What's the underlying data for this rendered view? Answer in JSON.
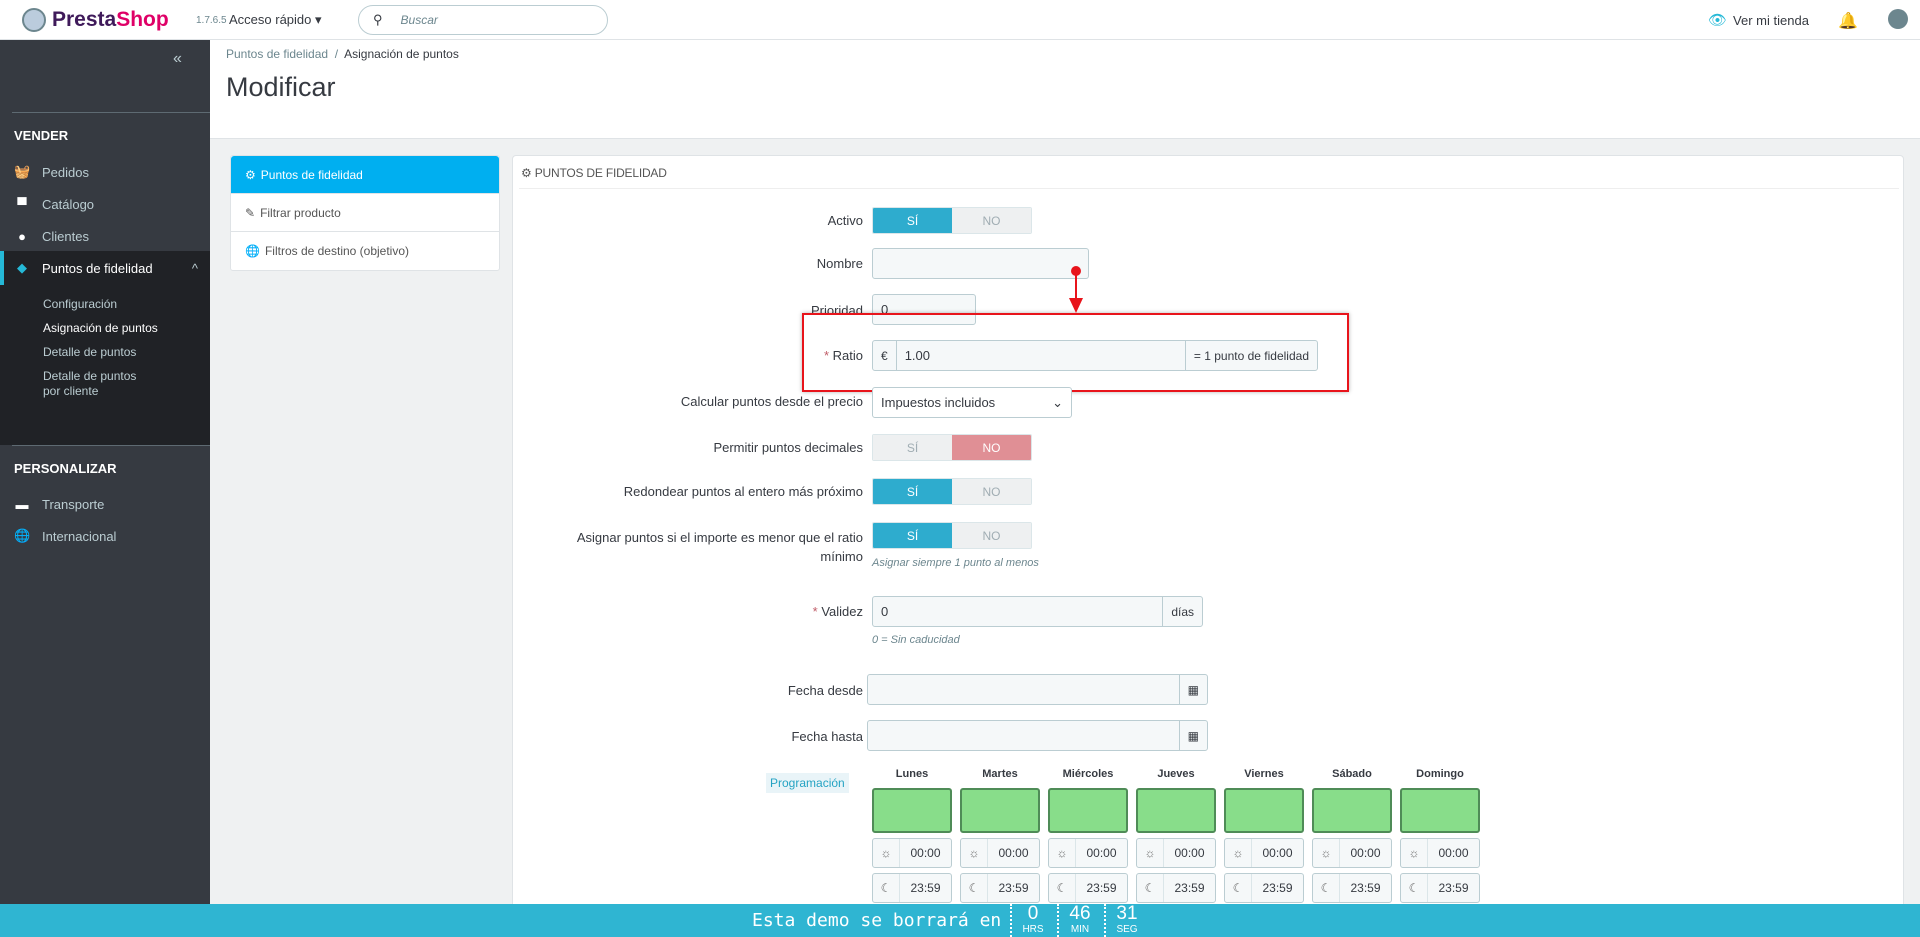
{
  "topbar": {
    "brand_a": "Presta",
    "brand_b": "Shop",
    "version": "1.7.6.5",
    "quick_access": "Acceso rápido",
    "search_placeholder": "Buscar",
    "view_store": "Ver mi tienda"
  },
  "sidebar": {
    "sections": [
      {
        "title": "VENDER",
        "items": [
          "Pedidos",
          "Catálogo",
          "Clientes",
          "Puntos de fidelidad"
        ]
      },
      {
        "title": "PERSONALIZAR",
        "items": [
          "Transporte",
          "Internacional"
        ]
      }
    ],
    "submenu": [
      "Configuración",
      "Asignación de puntos",
      "Detalle de puntos",
      "Detalle de puntos por cliente"
    ]
  },
  "header": {
    "breadcrumb": [
      "Puntos de fidelidad",
      "Asignación de puntos"
    ],
    "title": "Modificar"
  },
  "tabs": [
    "Puntos de fidelidad",
    "Filtrar producto",
    "Filtros de destino (objetivo)"
  ],
  "panel": {
    "title": "PUNTOS DE FIDELIDAD",
    "yes": "SÍ",
    "no": "NO",
    "activo": "Activo",
    "nombre": "Nombre",
    "nombre_value": "",
    "prioridad": "Prioridad",
    "prioridad_value": "0",
    "ratio": "Ratio",
    "ratio_currency": "€",
    "ratio_value": "1.00",
    "ratio_suffix": "= 1 punto de fidelidad",
    "calcular": "Calcular puntos desde el precio",
    "calcular_value": "Impuestos incluidos",
    "permitir": "Permitir puntos decimales",
    "redondear": "Redondear puntos al entero más próximo",
    "asignar": "Asignar puntos si el importe es menor que el ratio mínimo",
    "asignar_help": "Asignar siempre 1 punto al menos",
    "validez": "Validez",
    "validez_value": "0",
    "validez_suffix": "días",
    "validez_help": "0 = Sin caducidad",
    "fecha_desde": "Fecha desde",
    "fecha_hasta": "Fecha hasta",
    "programacion": "Programación",
    "days": [
      {
        "name": "Lunes",
        "from": "00:00",
        "to": "23:59"
      },
      {
        "name": "Martes",
        "from": "00:00",
        "to": "23:59"
      },
      {
        "name": "Miércoles",
        "from": "00:00",
        "to": "23:59"
      },
      {
        "name": "Jueves",
        "from": "00:00",
        "to": "23:59"
      },
      {
        "name": "Viernes",
        "from": "00:00",
        "to": "23:59"
      },
      {
        "name": "Sábado",
        "from": "00:00",
        "to": "23:59"
      },
      {
        "name": "Domingo",
        "from": "00:00",
        "to": "23:59"
      }
    ]
  },
  "demo": {
    "text": "Esta demo se borrará en",
    "hours": "0",
    "hours_label": "HRS",
    "minutes": "46",
    "minutes_label": "MIN",
    "seconds": "31",
    "seconds_label": "SEG"
  }
}
